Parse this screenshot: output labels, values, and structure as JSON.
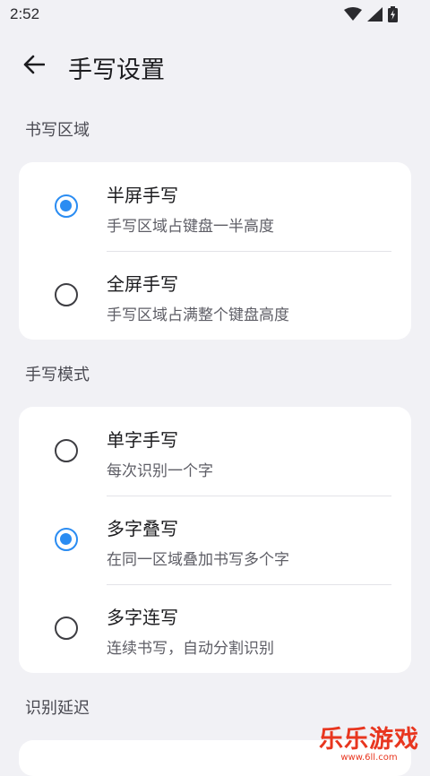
{
  "status_bar": {
    "time": "2:52"
  },
  "header": {
    "title": "手写设置"
  },
  "sections": [
    {
      "title": "书写区域",
      "options": [
        {
          "title": "半屏手写",
          "subtitle": "手写区域占键盘一半高度",
          "checked": true
        },
        {
          "title": "全屏手写",
          "subtitle": "手写区域占满整个键盘高度",
          "checked": false
        }
      ]
    },
    {
      "title": "手写模式",
      "options": [
        {
          "title": "单字手写",
          "subtitle": "每次识别一个字",
          "checked": false
        },
        {
          "title": "多字叠写",
          "subtitle": "在同一区域叠加书写多个字",
          "checked": true
        },
        {
          "title": "多字连写",
          "subtitle": "连续书写，自动分割识别",
          "checked": false
        }
      ]
    },
    {
      "title": "识别延迟"
    }
  ],
  "watermark": {
    "logo": "乐乐游戏",
    "url": "www.6ll.com"
  },
  "colors": {
    "accent": "#2a8cf2",
    "background": "#f1f1f5",
    "card": "#ffffff"
  }
}
